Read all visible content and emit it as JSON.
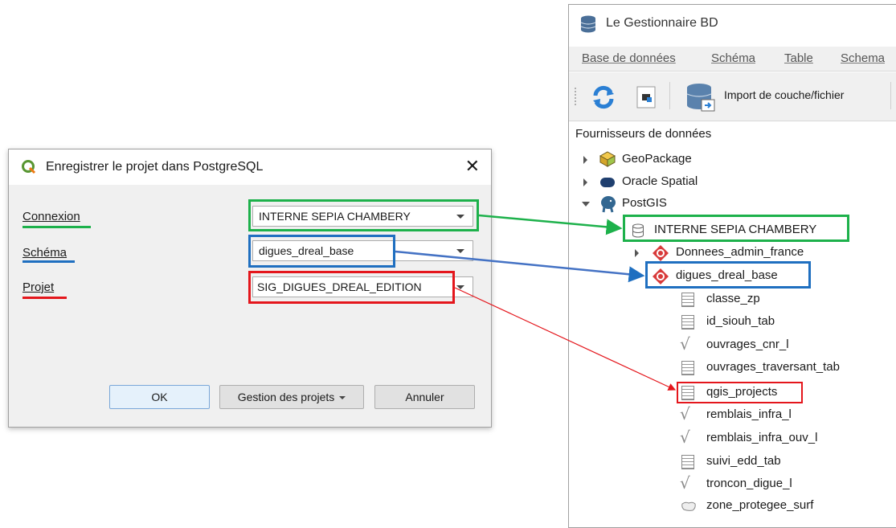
{
  "dialog": {
    "title": "Enregistrer le projet dans PostgreSQL",
    "close_label": "✕",
    "connexion_label": "Connexion",
    "schema_label": "Schéma",
    "projet_label": "Projet",
    "connexion_value": "INTERNE SEPIA CHAMBERY",
    "schema_value": "digues_dreal_base",
    "projet_value": "SIG_DIGUES_DREAL_EDITION",
    "ok_label": "OK",
    "manage_label": "Gestion des projets",
    "cancel_label": "Annuler"
  },
  "dbmanager": {
    "title": "Le Gestionnaire BD",
    "menus": [
      "Base de données",
      "Schéma",
      "Table",
      "Schema"
    ],
    "import_label": "Import de couche/fichier",
    "providers_header": "Fournisseurs de données",
    "providers": [
      "GeoPackage",
      "Oracle Spatial",
      "PostGIS"
    ],
    "connection": "INTERNE SEPIA CHAMBERY",
    "schemas": [
      "Donnees_admin_france",
      "digues_dreal_base"
    ],
    "tables": [
      {
        "name": "classe_zp",
        "icon": "table-icon"
      },
      {
        "name": "id_siouh_tab",
        "icon": "table-icon"
      },
      {
        "name": "ouvrages_cnr_l",
        "icon": "line-geometry-icon"
      },
      {
        "name": "ouvrages_traversant_tab",
        "icon": "table-icon"
      },
      {
        "name": "qgis_projects",
        "icon": "table-icon"
      },
      {
        "name": "remblais_infra_l",
        "icon": "line-geometry-icon"
      },
      {
        "name": "remblais_infra_ouv_l",
        "icon": "line-geometry-icon"
      },
      {
        "name": "suivi_edd_tab",
        "icon": "table-icon"
      },
      {
        "name": "troncon_digue_l",
        "icon": "line-geometry-icon"
      },
      {
        "name": "zone_protegee_surf",
        "icon": "polygon-geometry-icon"
      }
    ]
  },
  "colors": {
    "green": "#1db14b",
    "blue": "#1f6fc0",
    "red": "#e4161c",
    "postgis_red": "#d83a3a"
  }
}
